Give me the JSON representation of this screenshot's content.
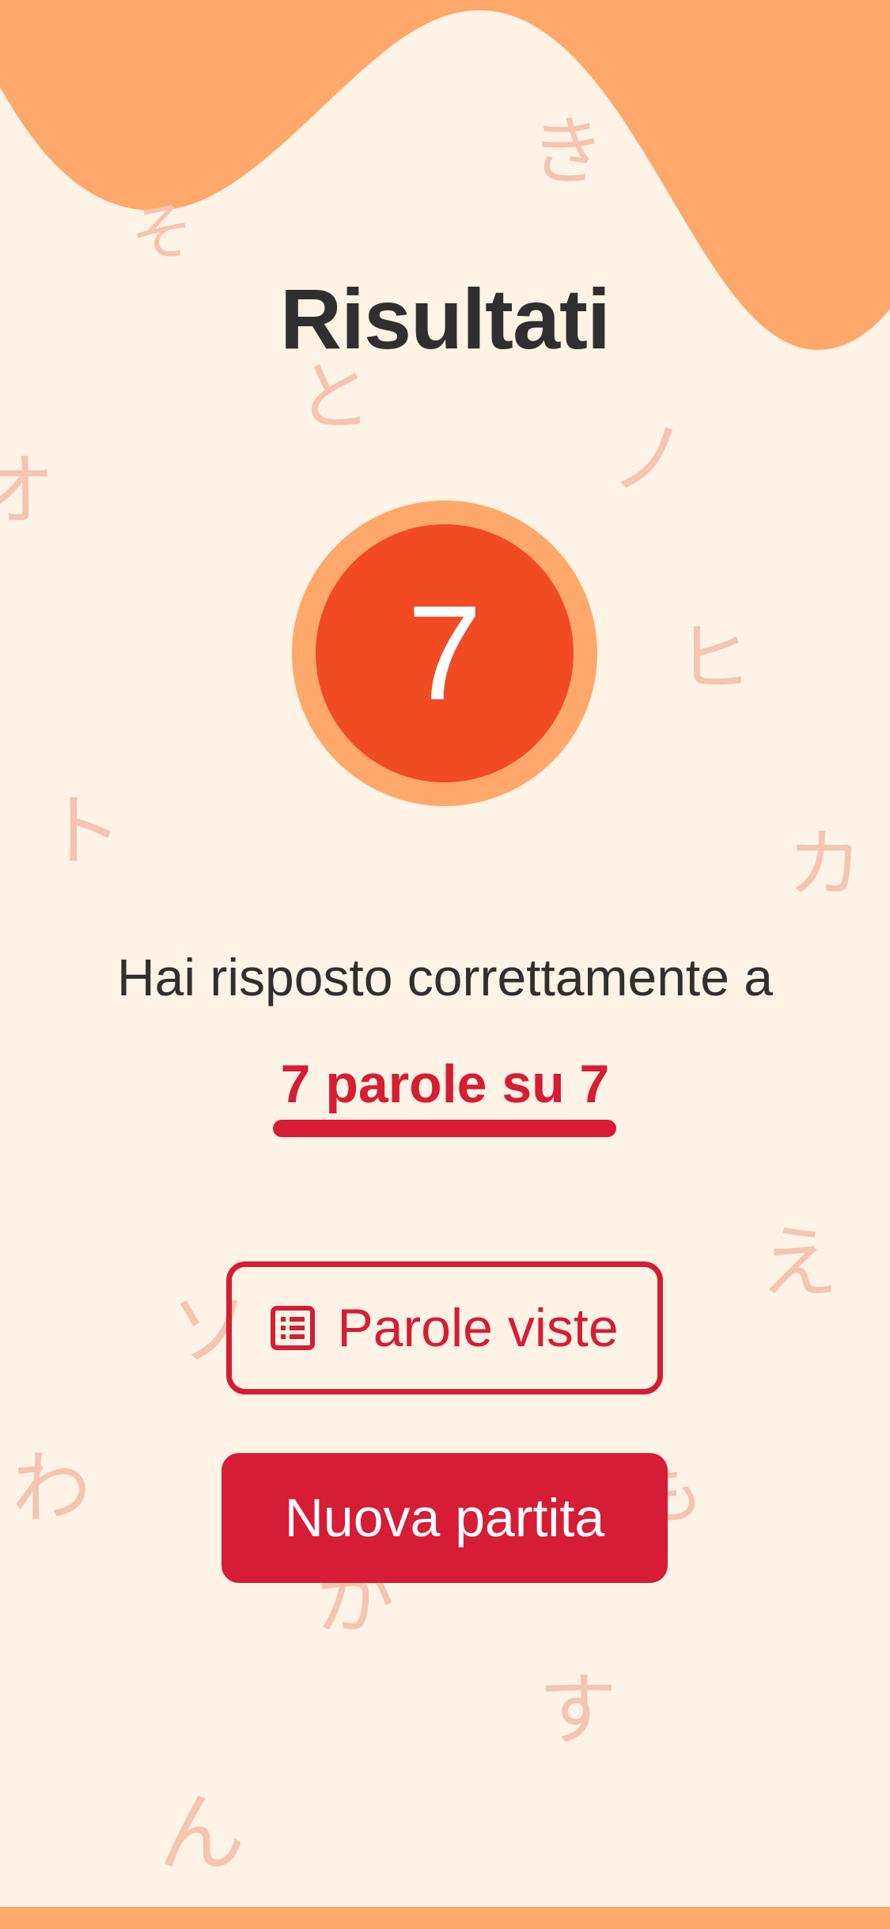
{
  "screen": {
    "title": "Risultati",
    "score": "7",
    "result_text": "Hai risposto correttamente a",
    "result_highlight": "7 parole su 7"
  },
  "buttons": {
    "seen_words_label": "Parole viste",
    "new_game_label": "Nuova partita"
  },
  "icons": {
    "list_icon": "list-icon"
  },
  "background_kana": [
    "そ",
    "き",
    "と",
    "ノ",
    "オ",
    "ヒ",
    "ト",
    "カ",
    "え",
    "ソ",
    "わ",
    "も",
    "が",
    "す",
    "ん"
  ],
  "colors": {
    "background": "#FEF3E4",
    "wave": "#FFA86B",
    "score_circle": "#F04B23",
    "accent_red": "#D61C37",
    "text_dark": "#2F2F2F",
    "kana": "#F3C5B2"
  }
}
